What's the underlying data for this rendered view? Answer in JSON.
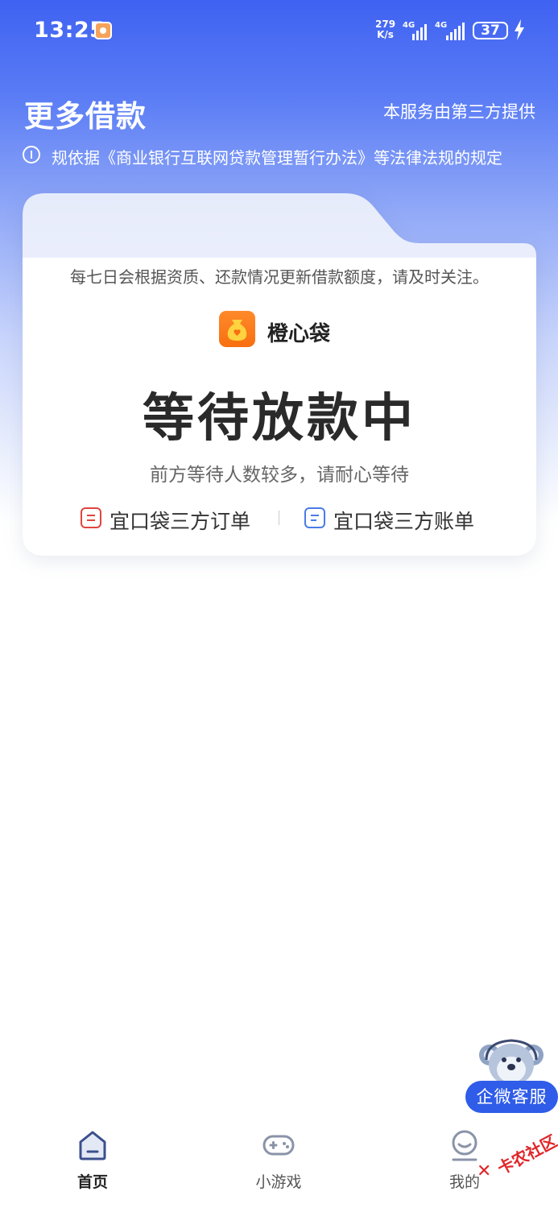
{
  "status_bar": {
    "time": "13:25",
    "net_speed_value": "279",
    "net_speed_unit": "K/s",
    "signal1_tag": "4G",
    "signal2_tag": "4G",
    "battery": "37"
  },
  "header": {
    "title": "更多借款",
    "third_party_note": "本服务由第三方提供",
    "notice": "规依据《商业银行互联网贷款管理暂行办法》等法律法规的规定"
  },
  "card": {
    "quota_note": "每七日会根据资质、还款情况更新借款额度，请及时关注。",
    "brand_name": "橙心袋",
    "status_title": "等待放款中",
    "status_subtitle": "前方等待人数较多，请耐心等待",
    "link_orders": "宜口袋三方订单",
    "link_bills": "宜口袋三方账单"
  },
  "support": {
    "label": "企微客服"
  },
  "tabbar": {
    "tabs": [
      {
        "label": "首页",
        "icon": "home-icon",
        "active": true
      },
      {
        "label": "小游戏",
        "icon": "gamepad-icon",
        "active": false
      },
      {
        "label": "我的",
        "icon": "profile-icon",
        "active": false
      }
    ]
  },
  "watermark": {
    "text": "卡农社区"
  },
  "colors": {
    "brand_blue": "#3f62f2",
    "support_blue": "#2f5ce8",
    "brand_orange": "#f76f10",
    "order_icon_red": "#e0443e",
    "bill_icon_blue": "#4a7be8",
    "tab_active": "#3b4f8c"
  }
}
